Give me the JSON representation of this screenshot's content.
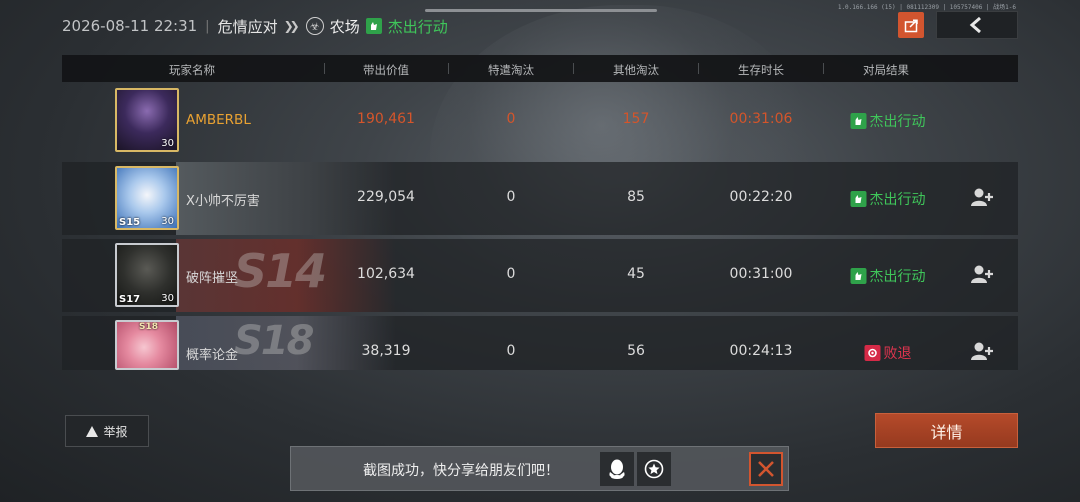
{
  "header": {
    "timestamp": "2026-08-11 22:31",
    "mode": "危情应对",
    "map": "农场",
    "result": "杰出行动",
    "session_id": "1.0.166.166 (15) | 081112309 | 105757406 | 战场1-6"
  },
  "table": {
    "columns": [
      "玩家名称",
      "带出价值",
      "特遣淘汰",
      "其他淘汰",
      "生存时长",
      "对局结果"
    ],
    "rows": [
      {
        "name": "AMBERBL",
        "value": "190,461",
        "special_kills": "0",
        "other_kills": "157",
        "survival": "00:31:06",
        "result": "杰出行动",
        "result_type": "win",
        "level": "30",
        "season": "",
        "is_self": true
      },
      {
        "name": "X小帅不厉害",
        "value": "229,054",
        "special_kills": "0",
        "other_kills": "85",
        "survival": "00:22:20",
        "result": "杰出行动",
        "result_type": "win",
        "level": "30",
        "season": "S15",
        "is_self": false
      },
      {
        "name": "破阵摧坚",
        "value": "102,634",
        "special_kills": "0",
        "other_kills": "45",
        "survival": "00:31:00",
        "result": "杰出行动",
        "result_type": "win",
        "level": "30",
        "season": "S17",
        "banner_text": "S14",
        "is_self": false
      },
      {
        "name": "概率论金",
        "value": "38,319",
        "special_kills": "0",
        "other_kills": "56",
        "survival": "00:24:13",
        "result": "败退",
        "result_type": "lose",
        "level": "",
        "season": "S18",
        "banner_text": "S18",
        "is_self": false
      }
    ]
  },
  "buttons": {
    "report": "举报",
    "details": "详情"
  },
  "toast": {
    "message": "截图成功，快分享给朋友们吧！"
  },
  "colors": {
    "win": "#3fc65a",
    "lose": "#e0354f",
    "self_name": "#e8a132",
    "self_values": "#d4552b",
    "accent": "#d2552f"
  },
  "icons": [
    "hazard-icon",
    "share-icon",
    "back-icon",
    "add-friend-icon",
    "warning-icon",
    "qq-icon",
    "star-icon",
    "close-icon"
  ]
}
